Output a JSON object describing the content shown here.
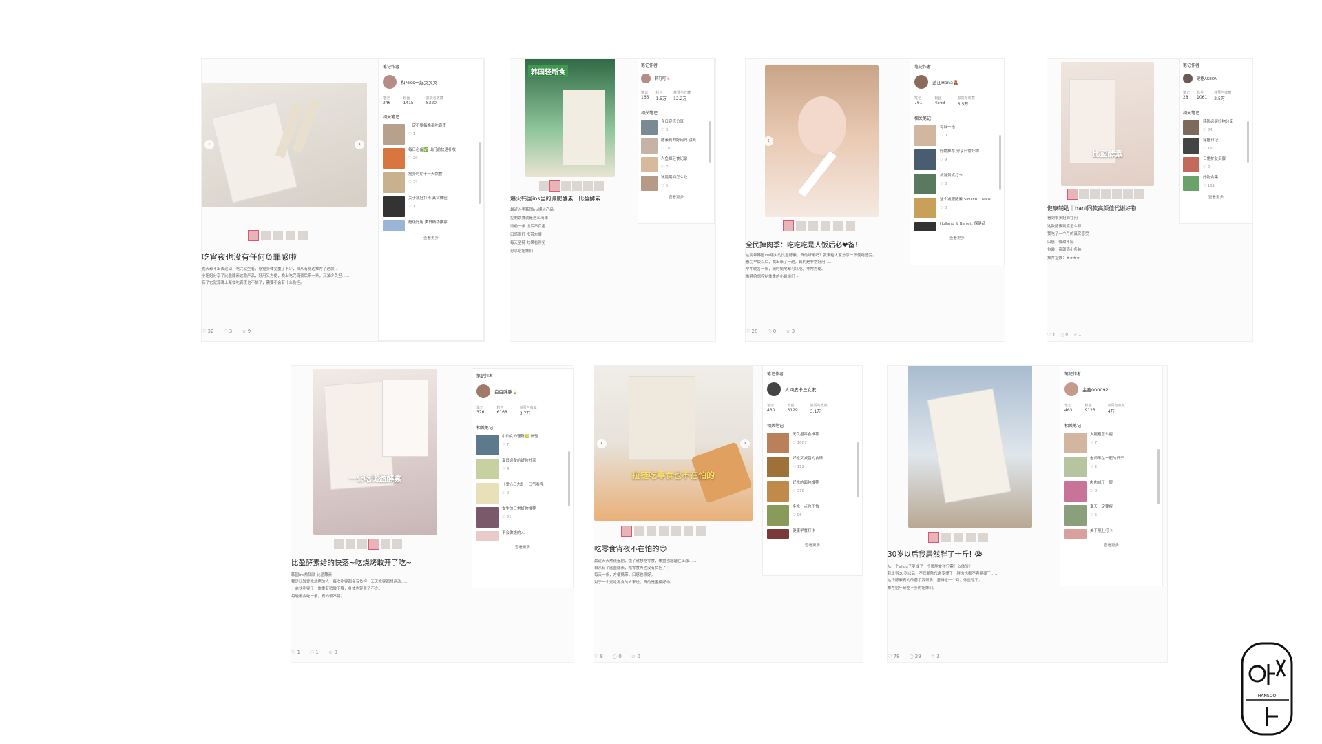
{
  "common": {
    "author_header": "笔记作者",
    "related_header": "相关笔记",
    "view_more": "查看更多",
    "stat_labels": [
      "笔记",
      "粉丝",
      "获赞与收藏"
    ]
  },
  "brand_logo": {
    "text": "HANSOO"
  },
  "cards": [
    {
      "id": "c1",
      "image_caption": "",
      "title": "吃宵夜也没有任何负罪感啦",
      "body": [
        "晚天都不出去运动，吃完就坐着，感觉身体变重了不少，自从有身边推荐了这款...",
        "小姐姐分享了比盈酵素这款产品，好用又方便，晚上吃完宵夜后来一条，又减少负担……",
        "有了它就算晚上聚餐吃宵夜也不怕了，需要不会有什么负担。"
      ],
      "stats": {
        "likes": "32",
        "comments": "3",
        "stars": "9"
      },
      "author": {
        "name": "和Miss一起哭哭哭",
        "notes": "246",
        "fans": "1415",
        "collects": "8320"
      },
      "related": [
        {
          "title": "一定不要每晚都吃宵夜",
          "likes": "1"
        },
        {
          "title": "每日必备✅ 出门前快速补妆",
          "likes": "20"
        },
        {
          "title": "瘦身时期十一天饮食",
          "likes": "27"
        },
        {
          "title": "关于痩肚打卡 真实体验",
          "likes": "1"
        },
        {
          "title": "超级好用 美白精华推荐",
          "likes": ""
        }
      ]
    },
    {
      "id": "c2",
      "image_caption": "韩国轻断食",
      "title": "爆火韩国ins里的减肥酵素 | 比盈酵素",
      "body": [
        "最近入手韩国ins爆火产品",
        "控制饮食就是这么简单",
        "饭前一条 饭后不负担",
        "口感很好 携带方便",
        "每天坚持 效果看得见",
        "分享给姐妹们"
      ],
      "stats": {
        "likes": "",
        "comments": "",
        "stars": ""
      },
      "author": {
        "name": "莉叮叮🍬",
        "notes": "165",
        "fans": "1.5万",
        "collects": "12.2万"
      },
      "related": [
        {
          "title": "今日穿搭分享",
          "likes": "3"
        },
        {
          "title": "酵素真的好用吗 讲真",
          "likes": "16"
        },
        {
          "title": "人鱼姬轻食记录",
          "likes": "7"
        },
        {
          "title": "减脂期间怎么吃",
          "likes": "5"
        }
      ]
    },
    {
      "id": "c3",
      "image_caption": "",
      "title": "全民掉肉季：吃吃吃是人饭后必❤备！",
      "body": [
        "这两年韩国ins爆火的比盈酵素，真的好用吗？我来给大家分享一下使用感受。",
        "看完早饭以后，我出来了一趟，真的是非常好用……",
        "早中晚各一条，随时随地都可以吃，非常方便。",
        "推荐给想控制体重的小姐姐们～"
      ],
      "stats": {
        "likes": "28",
        "comments": "0",
        "stars": "3"
      },
      "author": {
        "name": "蓝江Hana🧸",
        "notes": "761",
        "fans": "4563",
        "collects": "3.5万"
      },
      "related": [
        {
          "title": "每日一搭",
          "likes": "0"
        },
        {
          "title": "好物推荐 分享日常好物",
          "likes": "9"
        },
        {
          "title": "旅游景点打卡",
          "likes": "3"
        },
        {
          "title": "这个减肥酵素 SINTERO NMN",
          "likes": "8"
        },
        {
          "title": "Holland & Barrett 保健品",
          "likes": ""
        }
      ]
    },
    {
      "id": "c4",
      "image_caption": "比盈酵素",
      "title": "健康辅助｜hani同款高颜值代谢好物",
      "body": [
        "看到很多姐妹在问",
        "这款酵素到底怎么样",
        "我吃了一个月的真实感受",
        "口感：微甜不腻",
        "包装：高颜值小条装",
        "推荐指数：★★★★"
      ],
      "stats": {
        "likes": "4",
        "comments": "0",
        "stars": "1"
      },
      "author": {
        "name": "硬格ASEON",
        "notes": "28",
        "fans": "1061",
        "collects": "2.5万"
      },
      "related": [
        {
          "title": "韩国必买好物分享",
          "likes": "24"
        },
        {
          "title": "穿搭日记",
          "likes": "16"
        },
        {
          "title": "日常护肤步骤",
          "likes": "2"
        },
        {
          "title": "好物合集",
          "likes": "161"
        }
      ]
    },
    {
      "id": "c5",
      "image_caption": "一条吃比盈酵素",
      "title": "比盈酵素给的快落~吃烧烤敢开了吃~",
      "body": [
        "韩国ins热销款·比盈酵素",
        "我是比较爱吃烧烤的人，每次吃完都会有负担，天天吃完都想运动……",
        "一盒快吃完了，体重有稍微下降，身体也轻盈了不少。",
        "每晚都会吃一条，真的很不错。"
      ],
      "stats": {
        "likes": "1",
        "comments": "1",
        "stars": "0"
      },
      "author": {
        "name": "白白胖胖🍃",
        "notes": "376",
        "fans": "6168",
        "collects": "3.7万"
      },
      "related": [
        {
          "title": "小仙女的理财📒 体验",
          "likes": "7"
        },
        {
          "title": "夏日必备的好物分享",
          "likes": "4"
        },
        {
          "title": "【爱心日志】一口气看完",
          "likes": "0"
        },
        {
          "title": "女生的日常好物推荐",
          "likes": "21"
        },
        {
          "title": "不会做饭的人",
          "likes": ""
        }
      ]
    },
    {
      "id": "c6",
      "image_caption": "拉链吃零食也不在怕的",
      "title": "吃零食宵夜不在怕的😍",
      "body": [
        "最近天天熬夜追剧，饿了就想吃零食，体重也蹭蹭往上涨……",
        "自从有了比盈酵素，吃零食再也没有负担了！",
        "每天一条，方便携带，口感也很好。",
        "对于一个爱吃零食的人来说，真的是宝藏好物。"
      ],
      "stats": {
        "likes": "8",
        "comments": "0",
        "stars": "0"
      },
      "author": {
        "name": "人间皮卡丘女友",
        "notes": "430",
        "fans": "3129",
        "collects": "3.1万"
      },
      "related": [
        {
          "title": "无负担零食推荐",
          "likes": "1007"
        },
        {
          "title": "好吃又减脂的食谱",
          "likes": "112"
        },
        {
          "title": "好吃的面包推荐",
          "likes": "376"
        },
        {
          "title": "多吃一点也不怕",
          "likes": "96"
        },
        {
          "title": "健康早餐打卡",
          "likes": ""
        }
      ]
    },
    {
      "id": "c7",
      "image_caption": "",
      "title": "30岁以后我居然胖了十斤! 😭",
      "body": [
        "从一个shou子变成了一个微胖女孩只需什么体验？",
        "我觉得30岁以后，不仅新陈代谢变慢了，胖肉也都不容易掉了……",
        "这个酵素真的改善了我很多，坚持吃一个月，体重轻了。",
        "推荐给年龄差不多的姐妹们。"
      ],
      "stats": {
        "likes": "78",
        "comments": "29",
        "stars": "3"
      },
      "author": {
        "name": "金鑫000092",
        "notes": "463",
        "fans": "9123",
        "collects": "4万"
      },
      "related": [
        {
          "title": "大腿粗怎么瘦",
          "likes": "7"
        },
        {
          "title": "老师不在一起的日子",
          "likes": "2"
        },
        {
          "title": "肉肉减了一层",
          "likes": "0"
        },
        {
          "title": "夏天一定要瘦",
          "likes": "5"
        },
        {
          "title": "关于痩肚打卡",
          "likes": ""
        }
      ]
    }
  ],
  "colors": {
    "accent": "#e05577",
    "panel_border": "#eeeeee",
    "text": "#333333"
  }
}
